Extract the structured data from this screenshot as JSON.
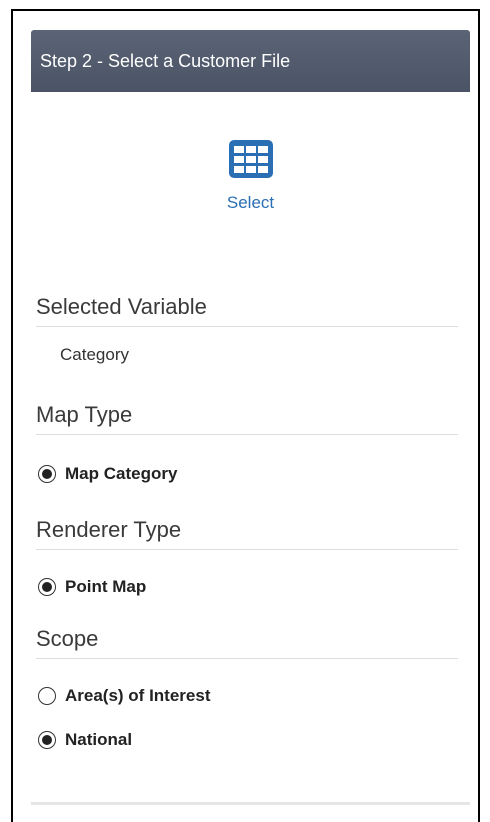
{
  "header": {
    "title": "Step 2 - Select a Customer File"
  },
  "select_button": {
    "icon": "grid-icon",
    "label": "Select",
    "color": "#2a6fb3"
  },
  "selected_variable": {
    "title": "Selected Variable",
    "value": "Category"
  },
  "map_type": {
    "title": "Map Type",
    "options": [
      {
        "label": "Map Category",
        "selected": true
      }
    ]
  },
  "renderer_type": {
    "title": "Renderer Type",
    "options": [
      {
        "label": "Point Map",
        "selected": true
      }
    ]
  },
  "scope": {
    "title": "Scope",
    "options": [
      {
        "label": "Area(s) of Interest",
        "selected": false
      },
      {
        "label": "National",
        "selected": true
      }
    ]
  },
  "colors": {
    "header_bg": "#4f596b",
    "accent": "#2a6fb3"
  }
}
